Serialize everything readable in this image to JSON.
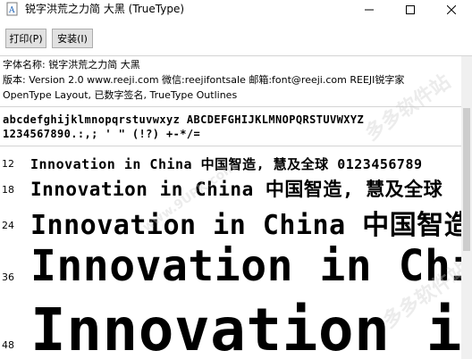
{
  "window": {
    "title": "锐字洪荒之力简 大黑 (TrueType)",
    "buttons": {
      "minimize": "—",
      "maximize": "☐",
      "close": "✕"
    }
  },
  "toolbar": {
    "print_label": "打印(P)",
    "install_label": "安装(I)"
  },
  "info": {
    "font_name": "字体名称: 锐字洪荒之力简 大黑",
    "version": "版本: Version 2.0  www.reeji.com 微信:reejifontsale 邮箱:font@reeji.com REEJI锐字家",
    "features": "OpenType Layout, 已数字签名, TrueType Outlines"
  },
  "charset": {
    "line1": "abcdefghijklmnopqrstuvwxyz ABCDEFGHIJKLMNOPQRSTUVWXYZ",
    "line2": "1234567890.:,; ' \" (!?) +-*/="
  },
  "samples": [
    {
      "size": "12",
      "text": "Innovation in China 中国智造, 慧及全球 0123456789"
    },
    {
      "size": "18",
      "text": "Innovation in China 中国智造, 慧及全球"
    },
    {
      "size": "24",
      "text": "Innovation in China 中国智造"
    },
    {
      "size": "36",
      "text": "Innovation in China"
    },
    {
      "size": "48",
      "text": "Innovation in"
    }
  ],
  "watermarks": [
    "www.9UPK.com",
    "多多软件站"
  ]
}
